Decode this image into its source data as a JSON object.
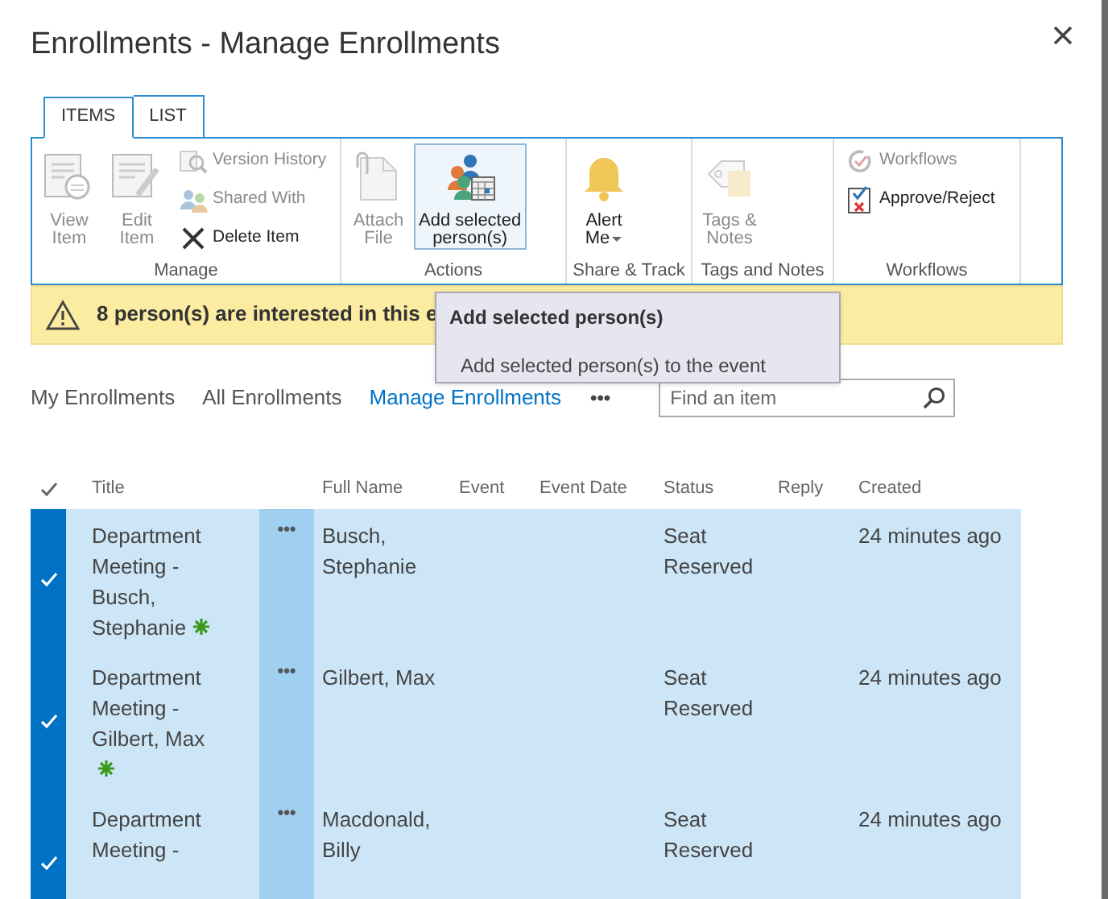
{
  "dialog": {
    "title": "Enrollments - Manage Enrollments"
  },
  "ribbon": {
    "tabs": [
      {
        "label": "ITEMS",
        "selected": true
      },
      {
        "label": "LIST",
        "selected": false
      }
    ],
    "groups": [
      {
        "label": "Manage",
        "items": [
          {
            "kind": "large",
            "lines": [
              "View",
              "Item"
            ],
            "disabled": true
          },
          {
            "kind": "large",
            "lines": [
              "Edit",
              "Item"
            ],
            "disabled": true
          },
          {
            "kind": "small",
            "lines": [
              "Version History"
            ],
            "disabled": true
          },
          {
            "kind": "small",
            "lines": [
              "Shared With"
            ],
            "disabled": true
          },
          {
            "kind": "small",
            "lines": [
              "Delete Item"
            ],
            "disabled": false
          }
        ]
      },
      {
        "label": "Actions",
        "items": [
          {
            "kind": "large",
            "lines": [
              "Attach",
              "File"
            ],
            "disabled": true
          },
          {
            "kind": "large",
            "lines": [
              "Add selected",
              "person(s)"
            ],
            "disabled": false,
            "highlighted": true
          }
        ]
      },
      {
        "label": "Share & Track",
        "items": [
          {
            "kind": "large",
            "lines": [
              "Alert",
              "Me"
            ],
            "disabled": false,
            "dropdown": true
          }
        ]
      },
      {
        "label": "Tags and Notes",
        "items": [
          {
            "kind": "large",
            "lines": [
              "Tags &",
              "Notes"
            ],
            "disabled": true
          }
        ]
      },
      {
        "label": "Workflows",
        "items": [
          {
            "kind": "small",
            "lines": [
              "Workflows"
            ],
            "disabled": true
          },
          {
            "kind": "small",
            "lines": [
              "Approve/Reject"
            ],
            "disabled": false
          }
        ]
      }
    ]
  },
  "notification": {
    "text": "8 person(s) are interested in this e"
  },
  "tooltip": {
    "title": "Add selected person(s)",
    "description": "Add selected person(s) to the event"
  },
  "views": [
    {
      "label": "My Enrollments",
      "selected": false
    },
    {
      "label": "All Enrollments",
      "selected": false
    },
    {
      "label": "Manage Enrollments",
      "selected": true
    }
  ],
  "more_views": "•••",
  "search": {
    "placeholder": "Find an item"
  },
  "table": {
    "columns": [
      "Title",
      "Full Name",
      "Event",
      "Event Date",
      "Status",
      "Reply",
      "Created"
    ],
    "rows": [
      {
        "selected": true,
        "title": "Department Meeting - Busch, Stephanie",
        "new": true,
        "full_name": "Busch, Stephanie",
        "status": "Seat Reserved",
        "created": "24 minutes ago",
        "menu": "•••"
      },
      {
        "selected": true,
        "title": "Department Meeting - Gilbert, Max",
        "new": true,
        "full_name": "Gilbert, Max",
        "status": "Seat Reserved",
        "created": "24 minutes ago",
        "menu": "•••"
      },
      {
        "selected": true,
        "title": "Department Meeting -",
        "new": false,
        "full_name": "Macdonald, Billy",
        "status": "Seat Reserved",
        "created": "24 minutes ago",
        "menu": "•••"
      }
    ]
  }
}
